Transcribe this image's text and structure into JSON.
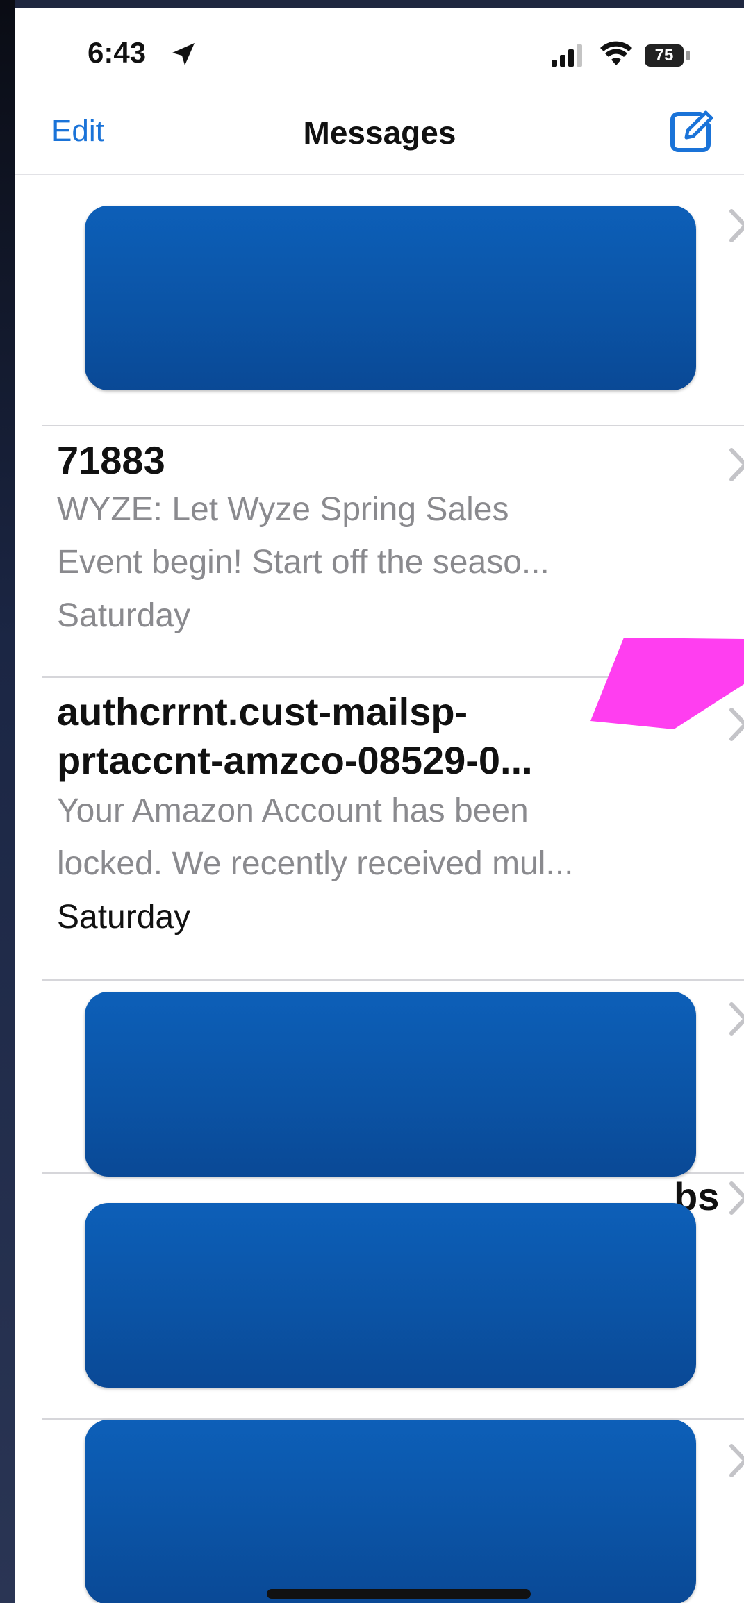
{
  "status_bar": {
    "time": "6:43",
    "battery": "75",
    "icons": [
      "location-arrow-icon",
      "signal-icon",
      "wifi-icon",
      "battery-icon"
    ]
  },
  "nav": {
    "edit_label": "Edit",
    "title": "Messages",
    "compose_icon": "compose-icon"
  },
  "messages": [
    {
      "sender": "",
      "preview": "",
      "date": "",
      "redacted": true
    },
    {
      "sender": "71883",
      "preview_line1": "WYZE: Let Wyze Spring Sales",
      "preview_line2": "Event begin! Start off the seaso...",
      "date": "Saturday",
      "redacted": false
    },
    {
      "sender_line1": "authcrrnt.cust-mailsp-",
      "sender_line2": "prtaccnt-amzco-08529-0...",
      "preview_line1": "Your Amazon Account has been",
      "preview_line2": "locked. We recently received mul...",
      "date": "Saturday",
      "redacted": false
    },
    {
      "sender": "",
      "preview": "",
      "date": "",
      "redacted": true
    },
    {
      "sender_peek": "bs",
      "redacted": true
    },
    {
      "sender": "",
      "preview": "",
      "date": "",
      "redacted": true
    }
  ],
  "colors": {
    "accent": "#1a73d8",
    "redaction": "#0b54a6",
    "annotation_arrow": "#ff3ef0",
    "secondary_text": "#8a8a8e"
  }
}
